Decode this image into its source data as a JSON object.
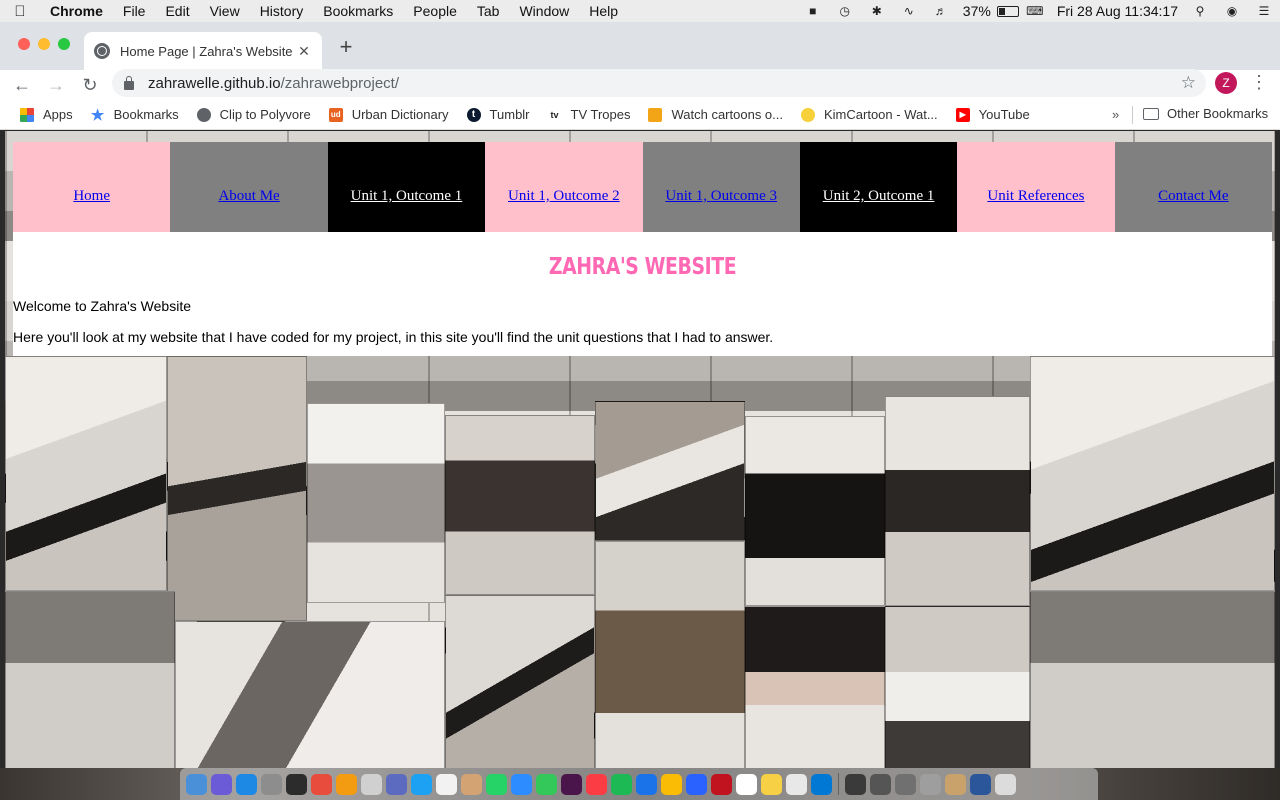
{
  "menubar": {
    "app_name": "Chrome",
    "items": [
      "File",
      "Edit",
      "View",
      "History",
      "Bookmarks",
      "People",
      "Tab",
      "Window",
      "Help"
    ],
    "battery": "37%",
    "battery_level": 0.37,
    "datetime": "Fri 28 Aug  11:34:17"
  },
  "browser": {
    "tab_title": "Home Page | Zahra's Website",
    "url_host": "zahrawelle.github.io",
    "url_path": "/zahrawebproject/",
    "profile_initial": "Z",
    "bookmarks": [
      {
        "label": "Apps",
        "icon": "apps-grid-icon"
      },
      {
        "label": "Bookmarks",
        "icon": "star-icon"
      },
      {
        "label": "Clip to Polyvore",
        "icon": "globe-icon"
      },
      {
        "label": "Urban Dictionary",
        "icon": "ud-icon"
      },
      {
        "label": "Tumblr",
        "icon": "tumblr-icon"
      },
      {
        "label": "TV Tropes",
        "icon": "tv-icon"
      },
      {
        "label": "Watch cartoons o...",
        "icon": "cartoon-icon"
      },
      {
        "label": "KimCartoon - Wat...",
        "icon": "kimcartoon-icon"
      },
      {
        "label": "YouTube",
        "icon": "youtube-icon"
      }
    ],
    "more_label": "»",
    "other_bookmarks": "Other Bookmarks"
  },
  "site": {
    "nav": [
      {
        "label": "Home",
        "style": "pink"
      },
      {
        "label": "About Me",
        "style": "grey"
      },
      {
        "label": "Unit 1, Outcome 1",
        "style": "black"
      },
      {
        "label": "Unit 1, Outcome 2",
        "style": "pink"
      },
      {
        "label": "Unit 1, Outcome 3",
        "style": "grey"
      },
      {
        "label": "Unit 2, Outcome 1",
        "style": "black"
      },
      {
        "label": "Unit References",
        "style": "pink"
      },
      {
        "label": "Contact Me",
        "style": "grey"
      }
    ],
    "title": "ZAHRA'S WEBSITE",
    "welcome": "Welcome to Zahra's Website",
    "intro": "Here you'll look at my website that I have coded for my project, in this site you'll find the unit questions that I had to answer."
  },
  "colors": {
    "nav_pink": "#ffc0cb",
    "nav_grey": "#808080",
    "nav_black": "#000000",
    "title_pink": "#ff69b4",
    "link_blue": "#0000ee"
  }
}
